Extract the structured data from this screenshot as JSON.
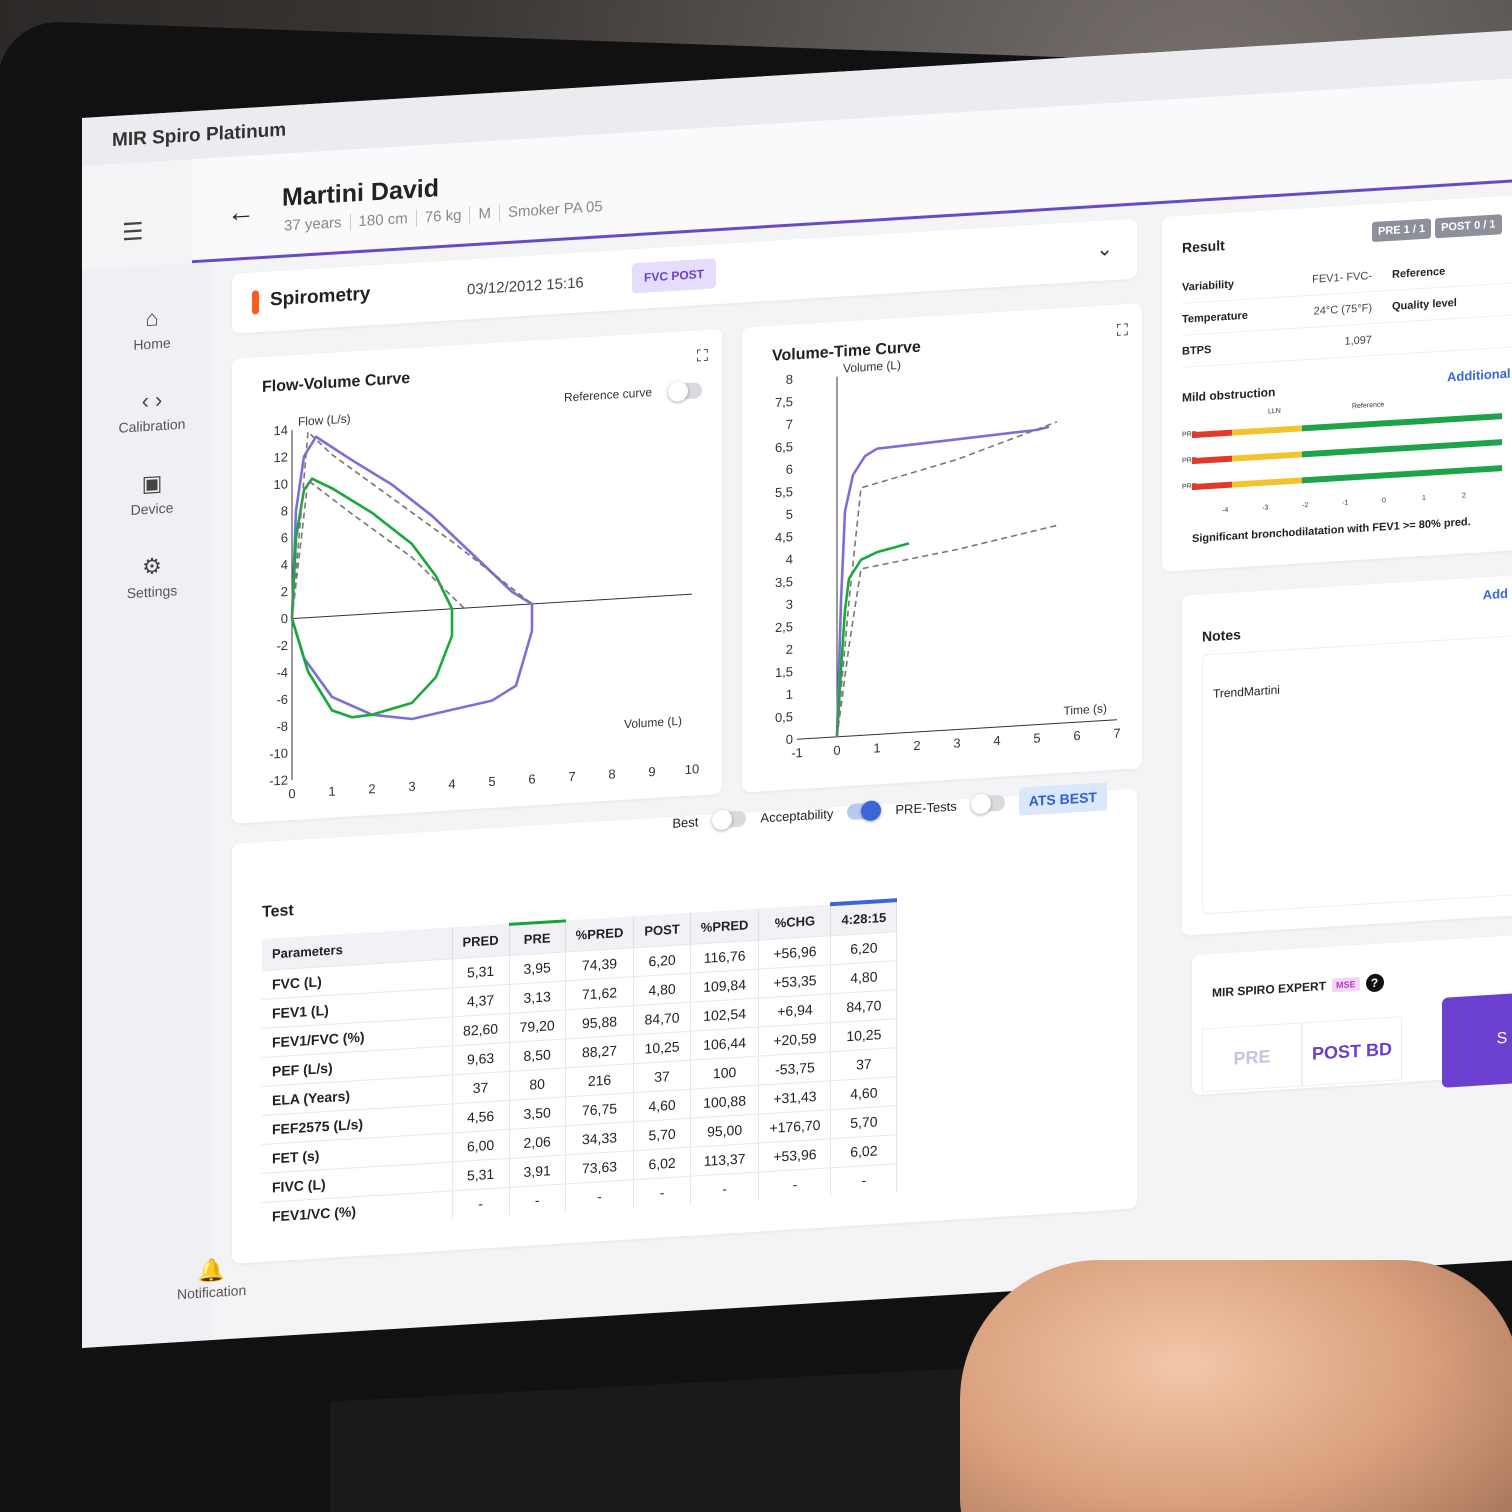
{
  "app": {
    "title": "MIR Spiro Platinum"
  },
  "patient": {
    "name": "Martini David",
    "age": "37 years",
    "height": "180 cm",
    "weight": "76 kg",
    "sex": "M",
    "smoker": "Smoker PA 05"
  },
  "nav": {
    "home": "Home",
    "calibration": "Calibration",
    "device": "Device",
    "settings": "Settings",
    "notification": "Notification"
  },
  "session": {
    "title": "Spirometry",
    "date": "03/12/2012 15:16",
    "badge": "FVC POST"
  },
  "flow_volume": {
    "title": "Flow-Volume Curve",
    "ref_label": "Reference curve"
  },
  "volume_time": {
    "title": "Volume-Time Curve"
  },
  "chart_data": [
    {
      "type": "line",
      "title": "Flow-Volume Curve",
      "xlabel": "Volume (L)",
      "ylabel": "Flow (L/s)",
      "xlim": [
        0,
        10
      ],
      "ylim": [
        -12,
        14
      ],
      "x_ticks": [
        "0",
        "1",
        "2",
        "3",
        "4",
        "5",
        "6",
        "7",
        "8",
        "9",
        "10"
      ],
      "y_ticks": [
        "-12",
        "-10",
        "-8",
        "-6",
        "-4",
        "-2",
        "0",
        "2",
        "4",
        "6",
        "8",
        "10",
        "12",
        "14"
      ],
      "series": [
        {
          "color": "#7c6fd6",
          "x": [
            0,
            0.1,
            0.3,
            0.6,
            1.5,
            2.5,
            3.5,
            4.5,
            5.5,
            6.0,
            6.0,
            5.6,
            5.0,
            4.0,
            3.0,
            2.0,
            1.0,
            0.3,
            0
          ],
          "y": [
            0,
            8,
            12,
            13.4,
            11.5,
            9.5,
            7,
            4,
            1,
            0,
            -2,
            -6,
            -7,
            -7.5,
            -8,
            -7.5,
            -6,
            -3,
            0
          ]
        },
        {
          "color": "#19a83a",
          "x": [
            0,
            0.1,
            0.3,
            0.5,
            1.0,
            2.0,
            3.0,
            3.6,
            4.0,
            4.0,
            3.6,
            3.0,
            2.0,
            1.5,
            1.0,
            0.4,
            0
          ],
          "y": [
            0,
            6,
            9.5,
            10.3,
            9.5,
            7.5,
            5,
            2.5,
            0,
            -2,
            -5,
            -6.8,
            -7.5,
            -7.6,
            -7,
            -4,
            0
          ]
        },
        {
          "color": "#777777",
          "dashed": true,
          "x": [
            0,
            0.4,
            1.0,
            2.5,
            4.0,
            6.0
          ],
          "y": [
            0,
            13.8,
            12,
            8.5,
            5,
            0
          ]
        },
        {
          "color": "#777777",
          "dashed": true,
          "x": [
            0,
            0.4,
            1.5,
            3.0,
            4.3
          ],
          "y": [
            0,
            10.2,
            7.5,
            4,
            0
          ]
        }
      ]
    },
    {
      "type": "line",
      "title": "Volume-Time Curve",
      "xlabel": "Time (s)",
      "ylabel": "Volume (L)",
      "xlim": [
        -1,
        7
      ],
      "ylim": [
        0,
        8
      ],
      "x_ticks": [
        "-1",
        "0",
        "1",
        "2",
        "3",
        "4",
        "5",
        "6",
        "7"
      ],
      "y_ticks": [
        "0",
        "0,5",
        "1",
        "1,5",
        "2",
        "2,5",
        "3",
        "3,5",
        "4",
        "4,5",
        "5",
        "5,5",
        "6",
        "6,5",
        "7",
        "7,5",
        "8"
      ],
      "series": [
        {
          "color": "#7c6fd6",
          "x": [
            0,
            0.1,
            0.2,
            0.4,
            0.7,
            1.0,
            3.0,
            5.0,
            5.3
          ],
          "y": [
            0,
            3,
            5,
            5.8,
            6.2,
            6.35,
            6.45,
            6.55,
            6.6
          ]
        },
        {
          "color": "#19a83a",
          "x": [
            0,
            0.1,
            0.2,
            0.3,
            0.6,
            1.0,
            1.8
          ],
          "y": [
            0,
            1.5,
            2.8,
            3.5,
            3.9,
            4.05,
            4.2
          ]
        },
        {
          "color": "#777777",
          "dashed": true,
          "x": [
            0,
            0.3,
            0.6,
            3.0,
            5.5
          ],
          "y": [
            0,
            3,
            5.5,
            6.0,
            6.7
          ]
        },
        {
          "color": "#777777",
          "dashed": true,
          "x": [
            0,
            0.3,
            0.6,
            3.0,
            5.5
          ],
          "y": [
            0,
            2.0,
            3.7,
            4.0,
            4.4
          ]
        }
      ]
    }
  ],
  "table": {
    "title": "Test",
    "controls": {
      "best": "Best",
      "acceptability": "Acceptability",
      "pre_tests": "PRE-Tests",
      "ats": "ATS BEST"
    },
    "headers": [
      "Parameters",
      "PRED",
      "PRE",
      "%PRED",
      "POST",
      "%PRED",
      "%CHG",
      "4:28:15"
    ],
    "rows": [
      [
        "FVC (L)",
        "5,31",
        "3,95",
        "74,39",
        "6,20",
        "116,76",
        "+56,96",
        "6,20"
      ],
      [
        "FEV1 (L)",
        "4,37",
        "3,13",
        "71,62",
        "4,80",
        "109,84",
        "+53,35",
        "4,80"
      ],
      [
        "FEV1/FVC (%)",
        "82,60",
        "79,20",
        "95,88",
        "84,70",
        "102,54",
        "+6,94",
        "84,70"
      ],
      [
        "PEF (L/s)",
        "9,63",
        "8,50",
        "88,27",
        "10,25",
        "106,44",
        "+20,59",
        "10,25"
      ],
      [
        "ELA (Years)",
        "37",
        "80",
        "216",
        "37",
        "100",
        "-53,75",
        "37"
      ],
      [
        "FEF2575 (L/s)",
        "4,56",
        "3,50",
        "76,75",
        "4,60",
        "100,88",
        "+31,43",
        "4,60"
      ],
      [
        "FET (s)",
        "6,00",
        "2,06",
        "34,33",
        "5,70",
        "95,00",
        "+176,70",
        "5,70"
      ],
      [
        "FIVC (L)",
        "5,31",
        "3,91",
        "73,63",
        "6,02",
        "113,37",
        "+53,96",
        "6,02"
      ],
      [
        "FEV1/VC (%)",
        "-",
        "-",
        "-",
        "-",
        "-",
        "-",
        "-"
      ]
    ]
  },
  "result": {
    "title": "Result",
    "badges": [
      "PRE 1 / 1",
      "POST 0 / 1"
    ],
    "rows": [
      {
        "k": "Variability",
        "v": "FEV1- FVC-",
        "k2": "Reference"
      },
      {
        "k": "Temperature",
        "v": "24°C (75°F)",
        "k2": "Quality level"
      },
      {
        "k": "BTPS",
        "v": "1,097",
        "k2": ""
      }
    ],
    "interpretation": "Mild obstruction",
    "additional": "Additional",
    "bar_labels": [
      "PRE",
      "PRE",
      "PRE"
    ],
    "axis_top": [
      "LLN",
      "Reference"
    ],
    "axis_ticks": [
      "-4",
      "-3",
      "-2",
      "-1",
      "0",
      "1",
      "2"
    ],
    "conclusion": "Significant bronchodilatation with FEV1 >= 80% pred."
  },
  "notes": {
    "title": "Notes",
    "add": "Add",
    "content": "TrendMartini"
  },
  "expert": {
    "title": "MIR SPIRO EXPERT",
    "badge": "MSE",
    "help": "?",
    "pre": "PRE",
    "post": "POST BD",
    "action": "S"
  }
}
